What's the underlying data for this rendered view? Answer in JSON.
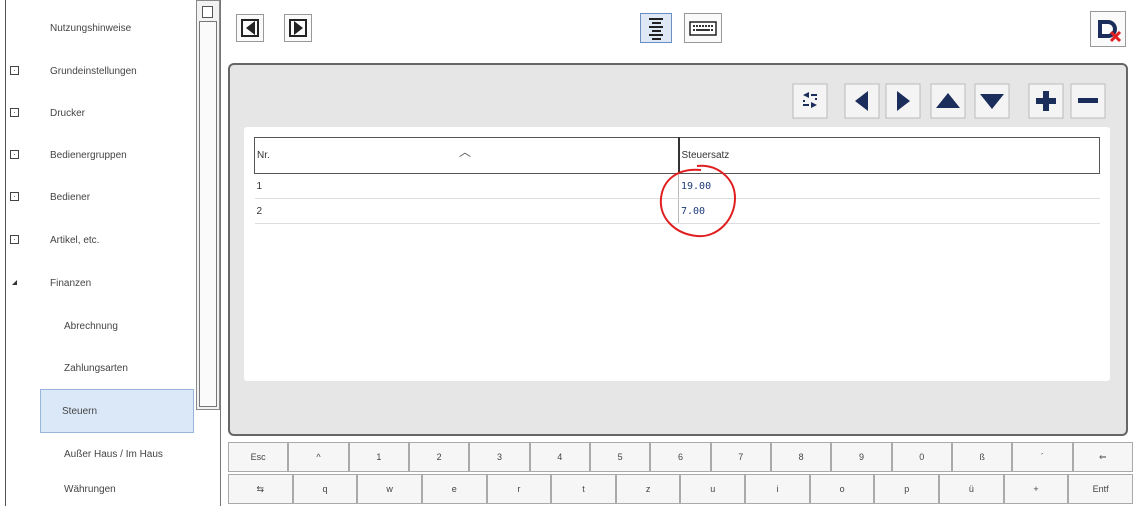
{
  "sidebar": {
    "items": [
      {
        "label": "Nutzungshinweise",
        "expander": "none"
      },
      {
        "label": "Grundeinstellungen",
        "expander": "+"
      },
      {
        "label": "Drucker",
        "expander": "+"
      },
      {
        "label": "Bedienergruppen",
        "expander": "+"
      },
      {
        "label": "Bediener",
        "expander": "+"
      },
      {
        "label": "Artikel, etc.",
        "expander": "+"
      },
      {
        "label": "Finanzen",
        "expander": "open"
      },
      {
        "label": "Abrechnung",
        "expander": "none"
      },
      {
        "label": "Zahlungsarten",
        "expander": "none"
      },
      {
        "label": "Steuern",
        "expander": "none",
        "selected": true
      },
      {
        "label": "Außer Haus / Im Haus",
        "expander": "none"
      },
      {
        "label": "Währungen",
        "expander": "none"
      }
    ]
  },
  "toolbar": {
    "icons": [
      "prev-page-icon",
      "next-page-icon",
      "list-view-icon",
      "keyboard-icon",
      "close-app-icon"
    ]
  },
  "grid_toolbar": {
    "icons": [
      "swap-columns-icon",
      "arrow-left-icon",
      "arrow-right-icon",
      "arrow-up-icon",
      "arrow-down-icon",
      "plus-icon",
      "minus-icon"
    ]
  },
  "table": {
    "headers": [
      "Nr.",
      "Steuersatz"
    ],
    "rows": [
      {
        "nr": "1",
        "rate": "19.00"
      },
      {
        "nr": "2",
        "rate": "7.00"
      }
    ]
  },
  "keyboard": {
    "row1": [
      "Esc",
      "^",
      "1",
      "2",
      "3",
      "4",
      "5",
      "6",
      "7",
      "8",
      "9",
      "0",
      "ß",
      "´",
      "⇐"
    ],
    "row2": [
      "⇆",
      "q",
      "w",
      "e",
      "r",
      "t",
      "z",
      "u",
      "i",
      "o",
      "p",
      "ü",
      "+",
      "Entf"
    ]
  },
  "colors": {
    "selected_bg": "#dbe8f8",
    "annotation": "#e02020",
    "value_text": "#1e3a7a",
    "nav_icon": "#1b2d5a"
  }
}
